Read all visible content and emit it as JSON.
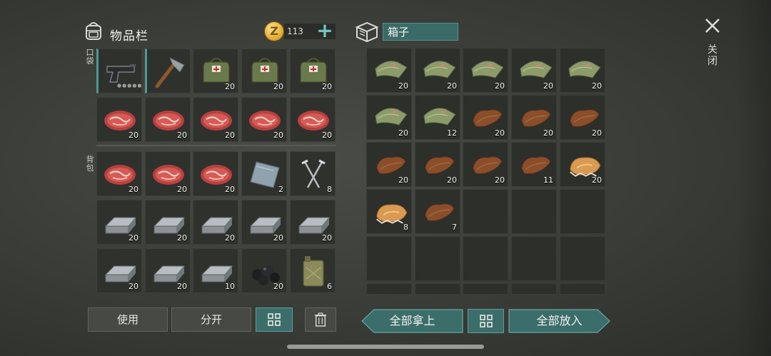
{
  "inventory": {
    "title": "物品栏",
    "pocket_label": "口袋",
    "backpack_label": "背包"
  },
  "currency": {
    "amount": "113",
    "add": "+"
  },
  "container": {
    "title": "箱子"
  },
  "close": {
    "label": "关闭"
  },
  "pocket": [
    {
      "item": "pistol",
      "count": "",
      "dots": "●●●●●"
    },
    {
      "item": "hatchet",
      "count": ""
    },
    {
      "item": "medkit",
      "count": "20"
    },
    {
      "item": "medkit",
      "count": "20"
    },
    {
      "item": "medkit",
      "count": "20"
    },
    {
      "item": "meat",
      "count": "20"
    },
    {
      "item": "meat",
      "count": "20"
    },
    {
      "item": "meat",
      "count": "20"
    },
    {
      "item": "meat",
      "count": "20"
    },
    {
      "item": "meat",
      "count": "20"
    }
  ],
  "backpack": [
    {
      "item": "meat",
      "count": "20"
    },
    {
      "item": "meat",
      "count": "20"
    },
    {
      "item": "meat",
      "count": "20"
    },
    {
      "item": "metal-plate",
      "count": "2"
    },
    {
      "item": "nails",
      "count": "8"
    },
    {
      "item": "iron-ingot",
      "count": "20"
    },
    {
      "item": "iron-ingot",
      "count": "20"
    },
    {
      "item": "iron-ingot",
      "count": "20"
    },
    {
      "item": "iron-ingot",
      "count": "20"
    },
    {
      "item": "iron-ingot",
      "count": "20"
    },
    {
      "item": "iron-ingot",
      "count": "20"
    },
    {
      "item": "iron-ingot",
      "count": "20"
    },
    {
      "item": "iron-ingot",
      "count": "10"
    },
    {
      "item": "coal",
      "count": "20"
    },
    {
      "item": "jerrycan",
      "count": "6"
    }
  ],
  "box": [
    {
      "item": "bandage-cloth",
      "count": "20"
    },
    {
      "item": "bandage-cloth",
      "count": "20"
    },
    {
      "item": "bandage-cloth",
      "count": "20"
    },
    {
      "item": "bandage-cloth",
      "count": "20"
    },
    {
      "item": "bandage-cloth",
      "count": "20"
    },
    {
      "item": "bandage-cloth",
      "count": "20"
    },
    {
      "item": "bandage-cloth",
      "count": "12"
    },
    {
      "item": "leather",
      "count": "20"
    },
    {
      "item": "leather",
      "count": "20"
    },
    {
      "item": "leather",
      "count": "20"
    },
    {
      "item": "leather",
      "count": "20"
    },
    {
      "item": "leather",
      "count": "20"
    },
    {
      "item": "leather",
      "count": "20"
    },
    {
      "item": "leather",
      "count": "11"
    },
    {
      "item": "fur",
      "count": "20"
    },
    {
      "item": "fur",
      "count": "8"
    },
    {
      "item": "leather",
      "count": "7"
    },
    {
      "item": "",
      "count": ""
    },
    {
      "item": "",
      "count": ""
    },
    {
      "item": "",
      "count": ""
    },
    {
      "item": "",
      "count": ""
    },
    {
      "item": "",
      "count": ""
    },
    {
      "item": "",
      "count": ""
    },
    {
      "item": "",
      "count": ""
    },
    {
      "item": "",
      "count": ""
    },
    {
      "item": "",
      "count": ""
    },
    {
      "item": "",
      "count": ""
    },
    {
      "item": "",
      "count": ""
    },
    {
      "item": "",
      "count": ""
    },
    {
      "item": "",
      "count": ""
    }
  ],
  "buttons": {
    "use": "使用",
    "split": "分开",
    "take_all": "全部拿上",
    "put_all": "全部放入"
  },
  "colors": {
    "teal": "#3b6e6a",
    "slot": "#2f312d"
  }
}
